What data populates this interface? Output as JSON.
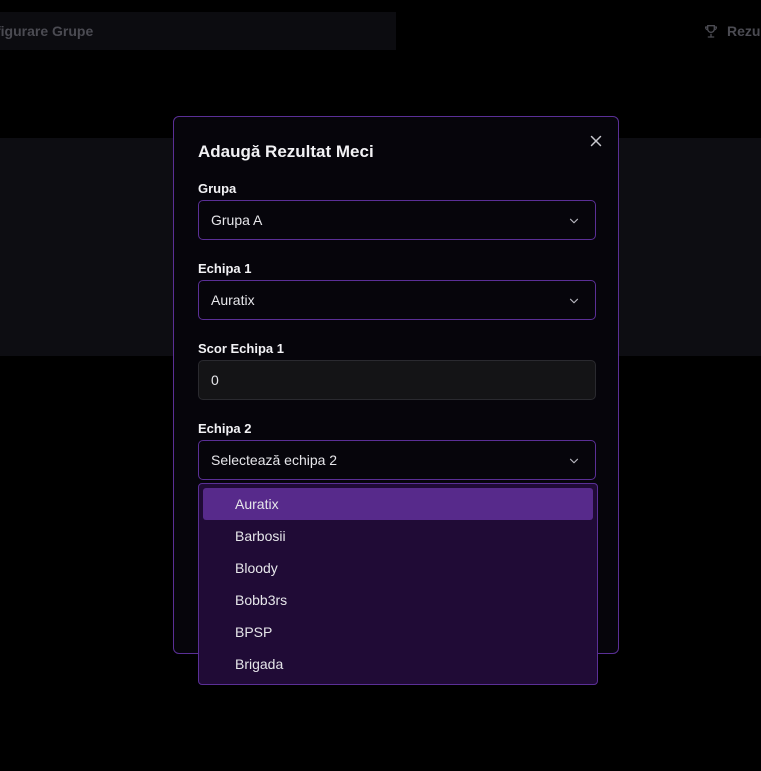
{
  "background": {
    "tabs": [
      {
        "label": "figurare Grupe",
        "icon": null
      },
      {
        "label": "Rezul",
        "icon": "trophy-icon"
      }
    ]
  },
  "modal": {
    "title": "Adaugă Rezultat Meci",
    "close_icon": "close-icon",
    "fields": {
      "grupa": {
        "label": "Grupa",
        "value": "Grupa A"
      },
      "echipa1": {
        "label": "Echipa 1",
        "value": "Auratix"
      },
      "scor1": {
        "label": "Scor Echipa 1",
        "value": "0"
      },
      "echipa2": {
        "label": "Echipa 2",
        "placeholder": "Selectează echipa 2"
      }
    }
  },
  "dropdown": {
    "options": [
      {
        "label": "Auratix",
        "highlighted": true
      },
      {
        "label": "Barbosii",
        "highlighted": false
      },
      {
        "label": "Bloody",
        "highlighted": false
      },
      {
        "label": "Bobb3rs",
        "highlighted": false
      },
      {
        "label": "BPSP",
        "highlighted": false
      },
      {
        "label": "Brigada",
        "highlighted": false
      }
    ]
  },
  "colors": {
    "accent_border": "#5a2f96",
    "dropdown_bg": "#200b36",
    "highlight": "#572a8b"
  }
}
